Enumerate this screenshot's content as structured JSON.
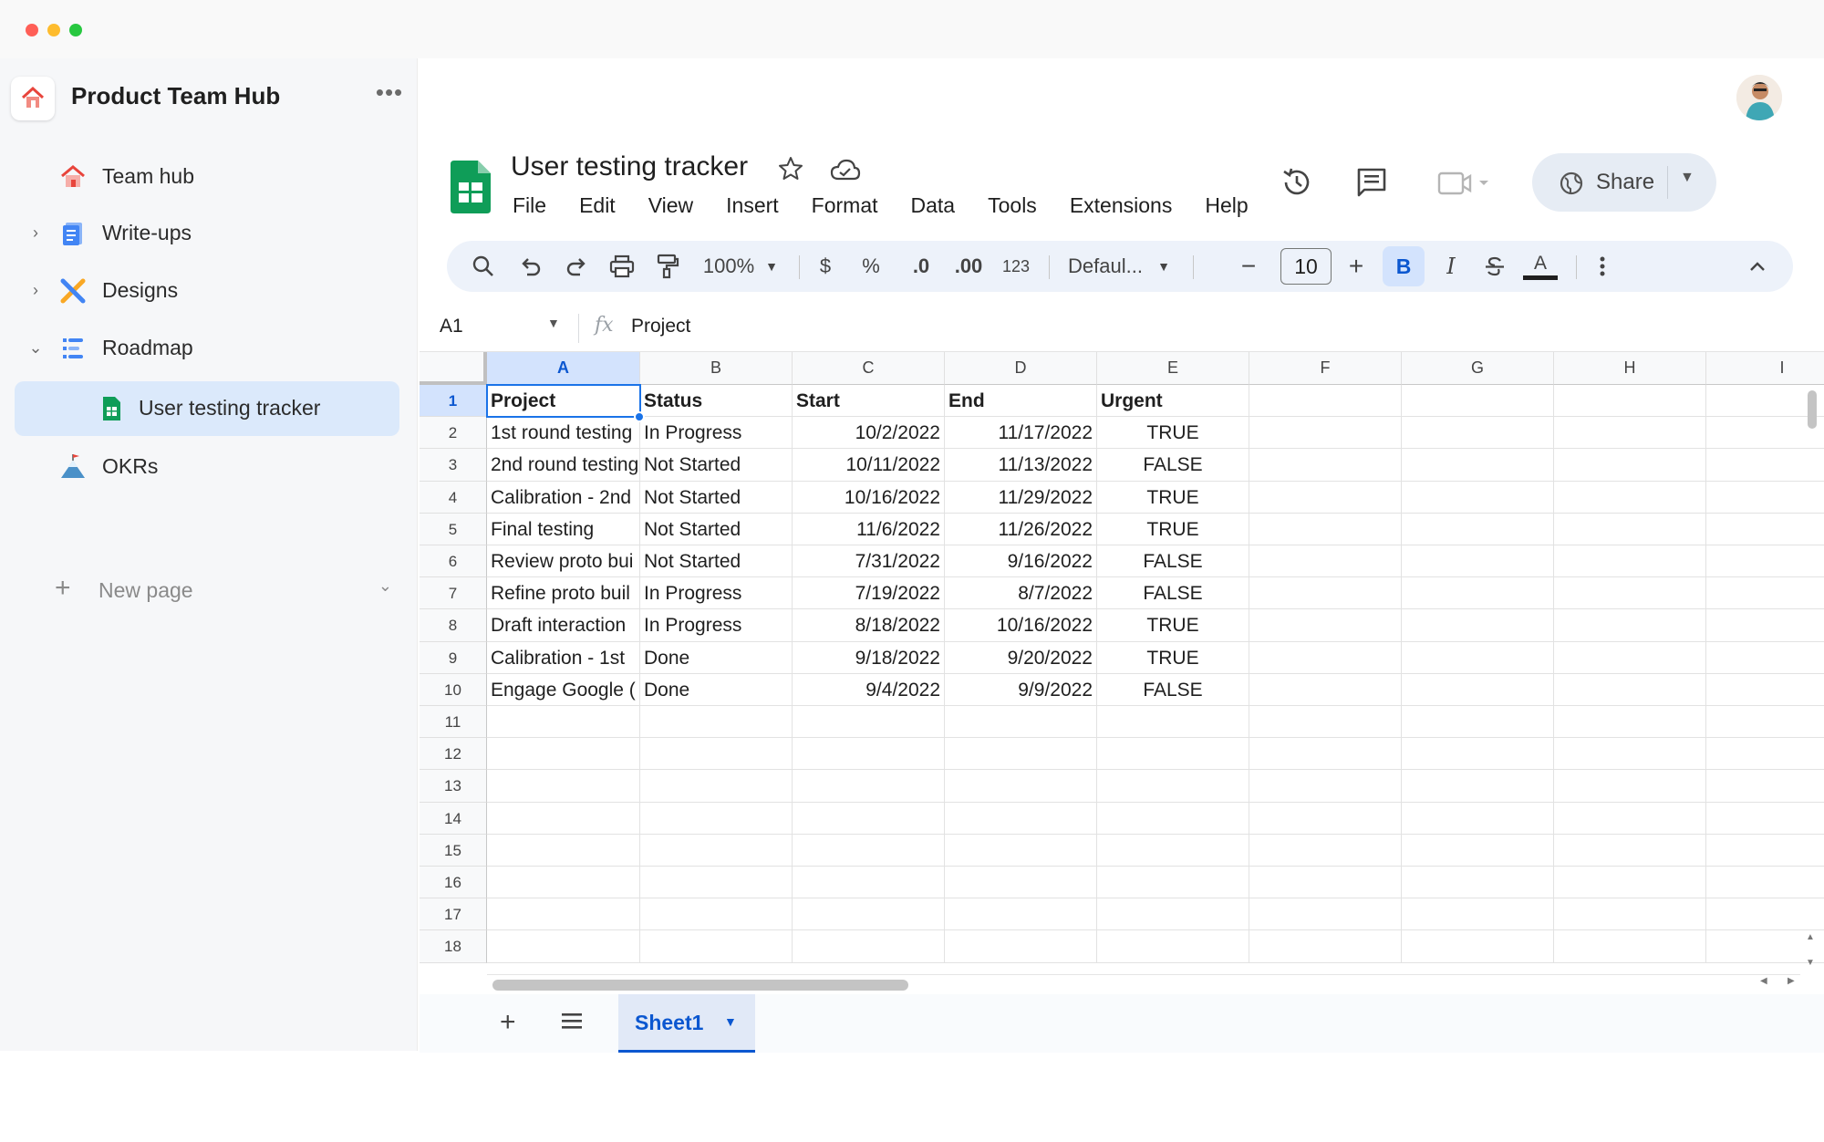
{
  "sidebar": {
    "title": "Product Team Hub",
    "more": "•••",
    "items": [
      {
        "label": "Team hub",
        "chevron": ""
      },
      {
        "label": "Write-ups",
        "chevron": "›"
      },
      {
        "label": "Designs",
        "chevron": "›"
      },
      {
        "label": "Roadmap",
        "chevron": "⌄"
      },
      {
        "label": "User testing tracker",
        "chevron": ""
      },
      {
        "label": "OKRs",
        "chevron": ""
      }
    ],
    "new_page": "New page"
  },
  "doc": {
    "title": "User testing tracker",
    "menu": [
      "File",
      "Edit",
      "View",
      "Insert",
      "Format",
      "Data",
      "Tools",
      "Extensions",
      "Help"
    ],
    "share_label": "Share"
  },
  "toolbar": {
    "zoom": "100%",
    "currency": "$",
    "percent": "%",
    "dec_decrease": ".0",
    "dec_increase": ".00",
    "number_format": "123",
    "font": "Defaul...",
    "font_size": "10",
    "bold": "B",
    "italic": "I",
    "text_color_letter": "A"
  },
  "formula_bar": {
    "cell_ref": "A1",
    "fx": "fx",
    "value": "Project"
  },
  "grid": {
    "columns": [
      "A",
      "B",
      "C",
      "D",
      "E",
      "F",
      "G",
      "H",
      "I"
    ],
    "row_numbers": [
      "1",
      "2",
      "3",
      "4",
      "5",
      "6",
      "7",
      "8",
      "9",
      "10",
      "11",
      "12",
      "13",
      "14",
      "15",
      "16",
      "17",
      "18"
    ],
    "header": [
      "Project",
      "Status",
      "Start",
      "End",
      "Urgent"
    ],
    "rows": [
      [
        "1st round testing",
        "In Progress",
        "10/2/2022",
        "11/17/2022",
        "TRUE"
      ],
      [
        "2nd round testing",
        "Not Started",
        "10/11/2022",
        "11/13/2022",
        "FALSE"
      ],
      [
        "Calibration - 2nd",
        "Not Started",
        "10/16/2022",
        "11/29/2022",
        "TRUE"
      ],
      [
        "Final testing",
        "Not Started",
        "11/6/2022",
        "11/26/2022",
        "TRUE"
      ],
      [
        "Review proto bui",
        "Not Started",
        "7/31/2022",
        "9/16/2022",
        "FALSE"
      ],
      [
        "Refine proto buil",
        "In Progress",
        "7/19/2022",
        "8/7/2022",
        "FALSE"
      ],
      [
        "Draft interaction",
        "In Progress",
        "8/18/2022",
        "10/16/2022",
        "TRUE"
      ],
      [
        "Calibration - 1st",
        "Done",
        "9/18/2022",
        "9/20/2022",
        "TRUE"
      ],
      [
        "Engage Google (",
        "Done",
        "9/4/2022",
        "9/9/2022",
        "FALSE"
      ]
    ]
  },
  "sheets": {
    "active": "Sheet1"
  },
  "colors": {
    "accent": "#0b57d0",
    "selection": "#1a73e8",
    "sheets_green": "#0f9d58",
    "sidebar_active": "#dbe9fb"
  }
}
